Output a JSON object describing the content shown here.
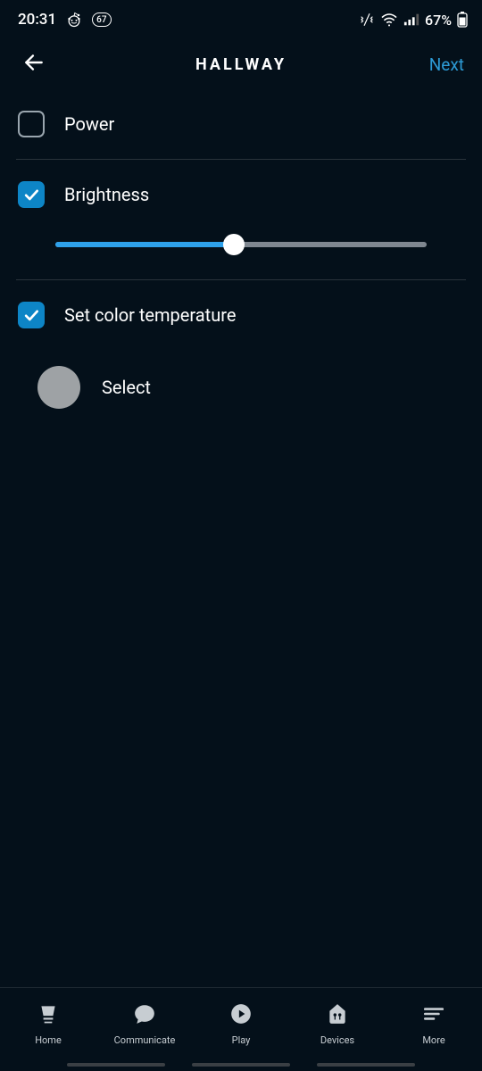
{
  "status": {
    "time": "20:31",
    "notif_count": "67",
    "battery": "67%"
  },
  "header": {
    "title": "HALLWAY",
    "next": "Next"
  },
  "options": {
    "power": {
      "label": "Power",
      "checked": false
    },
    "brightness": {
      "label": "Brightness",
      "checked": true,
      "value_pct": 48
    },
    "color_temp": {
      "label": "Set color temperature",
      "checked": true
    },
    "color_select": {
      "label": "Select",
      "swatch": "#9ea2a5"
    }
  },
  "nav": {
    "home": "Home",
    "communicate": "Communicate",
    "play": "Play",
    "devices": "Devices",
    "more": "More"
  }
}
